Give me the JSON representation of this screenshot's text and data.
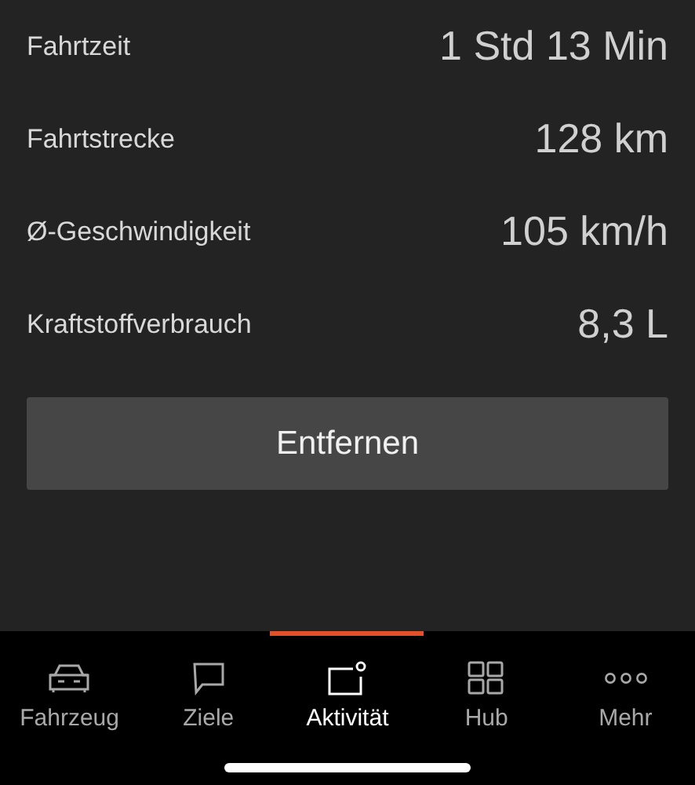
{
  "stats": [
    {
      "label": "Fahrtzeit",
      "value": "1 Std 13 Min"
    },
    {
      "label": "Fahrtstrecke",
      "value": "128 km"
    },
    {
      "label": "Ø-Geschwindigkeit",
      "value": "105 km/h"
    },
    {
      "label": "Kraftstoffverbrauch",
      "value": "8,3 L"
    }
  ],
  "remove_button": "Entfernen",
  "tabs": [
    {
      "label": "Fahrzeug",
      "kind": "car",
      "selected": false
    },
    {
      "label": "Ziele",
      "kind": "chat",
      "selected": false
    },
    {
      "label": "Aktivität",
      "kind": "activity",
      "selected": true
    },
    {
      "label": "Hub",
      "kind": "grid",
      "selected": false
    },
    {
      "label": "Mehr",
      "kind": "dots",
      "selected": false
    }
  ]
}
